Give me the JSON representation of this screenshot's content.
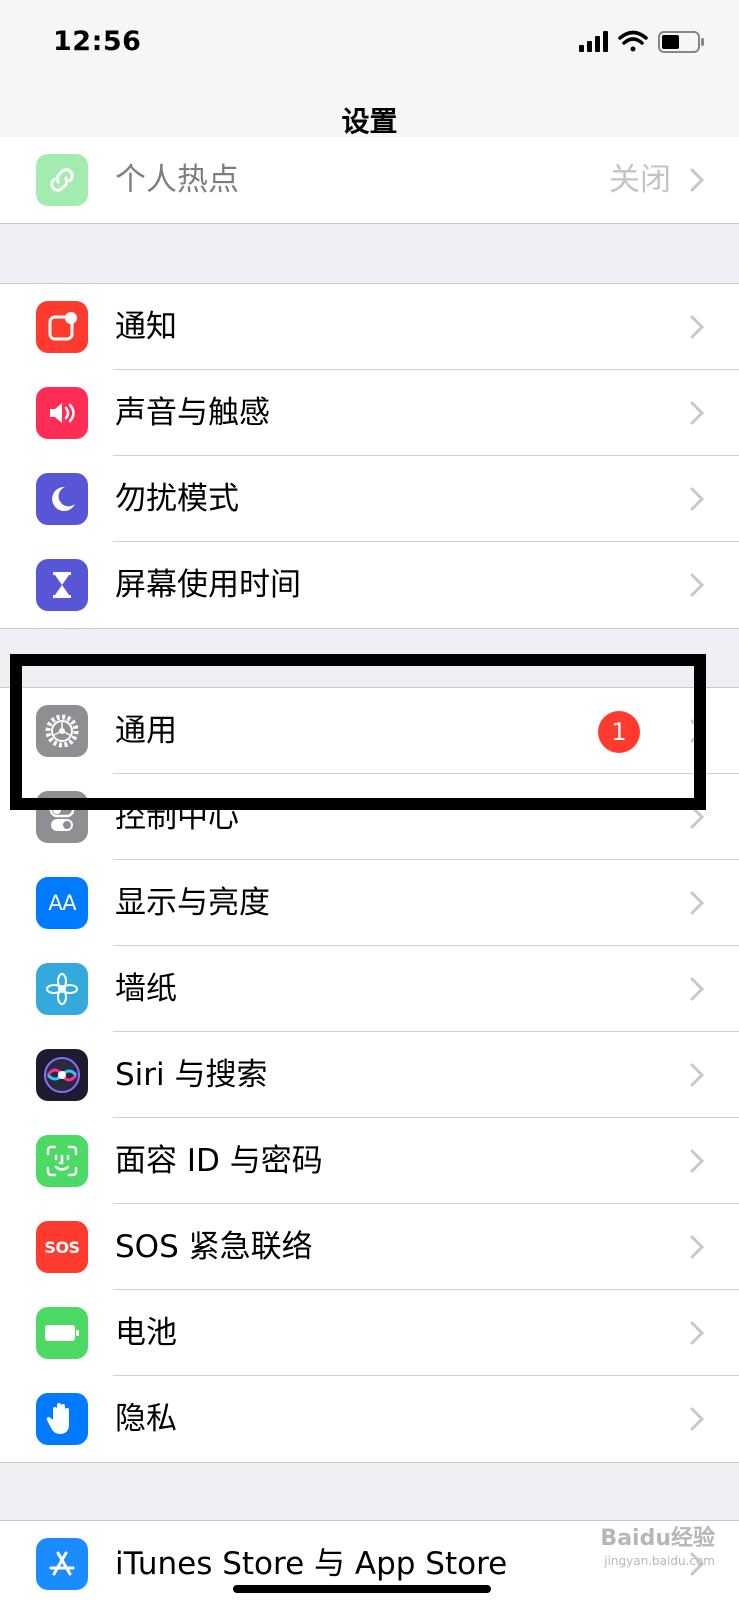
{
  "status_bar": {
    "time": "12:56",
    "icons": [
      "cellular-signal-icon",
      "wifi-icon",
      "battery-icon"
    ]
  },
  "nav": {
    "title": "设置"
  },
  "group_top": {
    "items": [
      {
        "label": "个人热点",
        "value": "关闭",
        "icon": "hotspot-icon",
        "color": "#4cd964"
      }
    ]
  },
  "group_notifications": {
    "items": [
      {
        "label": "通知",
        "icon": "notifications-icon",
        "color": "#ff3b30"
      },
      {
        "label": "声音与触感",
        "icon": "sound-icon",
        "color": "#ff2d55"
      },
      {
        "label": "勿扰模式",
        "icon": "moon-icon",
        "color": "#5856d6"
      },
      {
        "label": "屏幕使用时间",
        "icon": "hourglass-icon",
        "color": "#5856d6"
      }
    ]
  },
  "group_general": {
    "items": [
      {
        "label": "通用",
        "badge": "1",
        "icon": "gear-icon",
        "color": "#8e8e93"
      },
      {
        "label": "控制中心",
        "icon": "toggles-icon",
        "color": "#8e8e93"
      },
      {
        "label": "显示与亮度",
        "icon_text": "AA",
        "icon": "text-size-icon",
        "color": "#007aff"
      },
      {
        "label": "墙纸",
        "icon": "flower-icon",
        "color": "#34aadc"
      },
      {
        "label": "Siri 与搜索",
        "icon": "siri-icon",
        "color": "#1c1c2e"
      },
      {
        "label": "面容 ID 与密码",
        "icon": "face-id-icon",
        "color": "#4cd964"
      },
      {
        "label": "SOS 紧急联络",
        "icon_text": "SOS",
        "icon": "sos-icon",
        "color": "#ff3b30"
      },
      {
        "label": "电池",
        "icon": "battery-green-icon",
        "color": "#4cd964"
      },
      {
        "label": "隐私",
        "icon": "hand-icon",
        "color": "#007aff"
      }
    ]
  },
  "group_store": {
    "items": [
      {
        "label": "iTunes Store 与 App Store",
        "icon": "app-store-icon",
        "color": "#1a8cff"
      }
    ]
  },
  "watermark": {
    "text": "Baidu经验",
    "sub": "jingyan.baidu.com"
  }
}
